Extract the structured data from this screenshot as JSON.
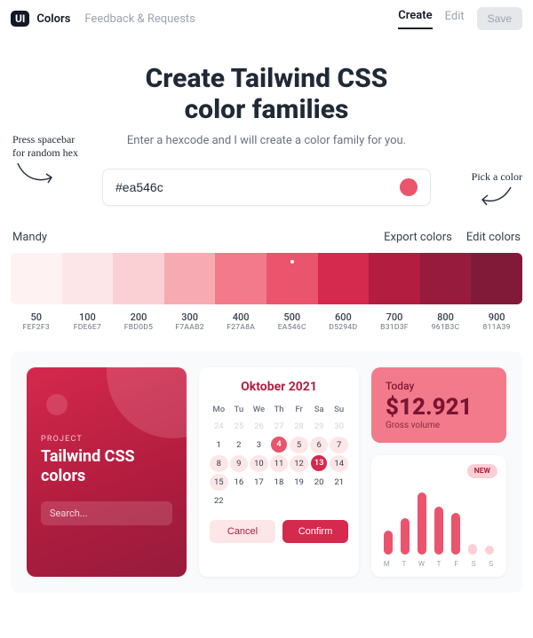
{
  "header": {
    "logo_badge": "UI",
    "logo_text": "Colors",
    "feedback": "Feedback & Requests",
    "tab_create": "Create",
    "tab_edit": "Edit",
    "save": "Save"
  },
  "hero": {
    "title_line1": "Create Tailwind CSS",
    "title_line2": "color families",
    "subtitle": "Enter a hexcode and I will create a color family for you.",
    "annotation_left_l1": "Press spacebar",
    "annotation_left_l2": "for random hex",
    "annotation_right": "Pick a color",
    "hex_value": "#ea546c",
    "picked_color": "#ea546c"
  },
  "palette": {
    "name": "Mandy",
    "export": "Export colors",
    "edit": "Edit colors",
    "active_shade": "500",
    "shades": [
      {
        "shade": "50",
        "hex": "FEF2F3",
        "color": "#fef2f3"
      },
      {
        "shade": "100",
        "hex": "FDE6E7",
        "color": "#fde6e7"
      },
      {
        "shade": "200",
        "hex": "FBD0D5",
        "color": "#fbd0d5"
      },
      {
        "shade": "300",
        "hex": "F7AAB2",
        "color": "#f7aab2"
      },
      {
        "shade": "400",
        "hex": "F27A8A",
        "color": "#f27a8a"
      },
      {
        "shade": "500",
        "hex": "EA546C",
        "color": "#ea546c"
      },
      {
        "shade": "600",
        "hex": "D5294D",
        "color": "#d5294d"
      },
      {
        "shade": "700",
        "hex": "B31D3F",
        "color": "#b31d3f"
      },
      {
        "shade": "800",
        "hex": "961B3C",
        "color": "#961b3c"
      },
      {
        "shade": "900",
        "hex": "811A39",
        "color": "#811a39"
      }
    ]
  },
  "project_card": {
    "eyebrow": "PROJECT",
    "title": "Tailwind CSS colors",
    "search_placeholder": "Search..."
  },
  "calendar": {
    "title": "Oktober 2021",
    "dow": [
      "Mo",
      "Tu",
      "We",
      "Th",
      "Fr",
      "Sa",
      "Su"
    ],
    "prev_tail": [
      24,
      25,
      26,
      27,
      28,
      29,
      30
    ],
    "weeks": [
      [
        1,
        2,
        3,
        4,
        5,
        6,
        7,
        8
      ],
      [
        9,
        10,
        11,
        12,
        13,
        14,
        15
      ],
      [
        16,
        17,
        18,
        19,
        20,
        21,
        22
      ]
    ],
    "selected": 4,
    "secondary_selected": 13,
    "highlight_week_start": 4,
    "cancel": "Cancel",
    "confirm": "Confirm"
  },
  "stat": {
    "label": "Today",
    "value": "$12.921",
    "sub": "Gross volume"
  },
  "chart_data": {
    "type": "bar",
    "badge": "NEW",
    "categories": [
      "M",
      "T",
      "W",
      "T",
      "F",
      "S",
      "S"
    ],
    "values": [
      28,
      42,
      72,
      55,
      48,
      12,
      10
    ],
    "soft_indices": [
      5,
      6
    ],
    "ylim": [
      0,
      80
    ],
    "title": "",
    "xlabel": "",
    "ylabel": ""
  }
}
